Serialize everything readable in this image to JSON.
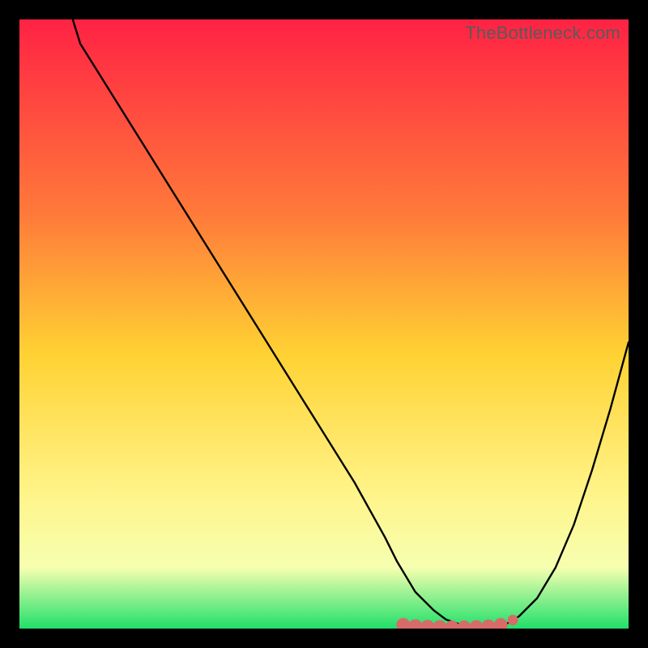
{
  "watermark": "TheBottleneck.com",
  "colors": {
    "frame": "#000000",
    "grad_top": "#ff2244",
    "grad_mid_upper": "#ff7a3a",
    "grad_mid": "#ffd233",
    "grad_mid_lower": "#fff48a",
    "grad_low": "#f6ffb0",
    "grad_bottom": "#20e06a",
    "curve": "#000000",
    "marker_fill": "#d96a6a",
    "marker_stroke": "#b84f4f"
  },
  "chart_data": {
    "type": "line",
    "title": "",
    "xlabel": "",
    "ylabel": "",
    "xlim": [
      0,
      100
    ],
    "ylim": [
      0,
      100
    ],
    "series": [
      {
        "name": "bottleneck-curve",
        "x": [
          0,
          5,
          10,
          15,
          20,
          25,
          30,
          35,
          40,
          45,
          50,
          55,
          60,
          62,
          65,
          68,
          70,
          72,
          75,
          78,
          80,
          82,
          85,
          88,
          91,
          94,
          97,
          100
        ],
        "y": [
          112,
          104,
          96,
          88,
          80,
          72,
          64,
          56,
          48,
          40,
          32,
          24,
          15,
          11,
          6,
          3,
          1.5,
          0.8,
          0.3,
          0.3,
          0.8,
          2,
          5,
          10,
          17,
          26,
          36,
          47
        ]
      }
    ],
    "markers": {
      "name": "optimal-range",
      "x": [
        63,
        65,
        67,
        69,
        71,
        73,
        75,
        77,
        79,
        81
      ],
      "y": [
        0.6,
        0.4,
        0.3,
        0.25,
        0.2,
        0.2,
        0.25,
        0.35,
        0.6,
        1.4
      ]
    }
  }
}
